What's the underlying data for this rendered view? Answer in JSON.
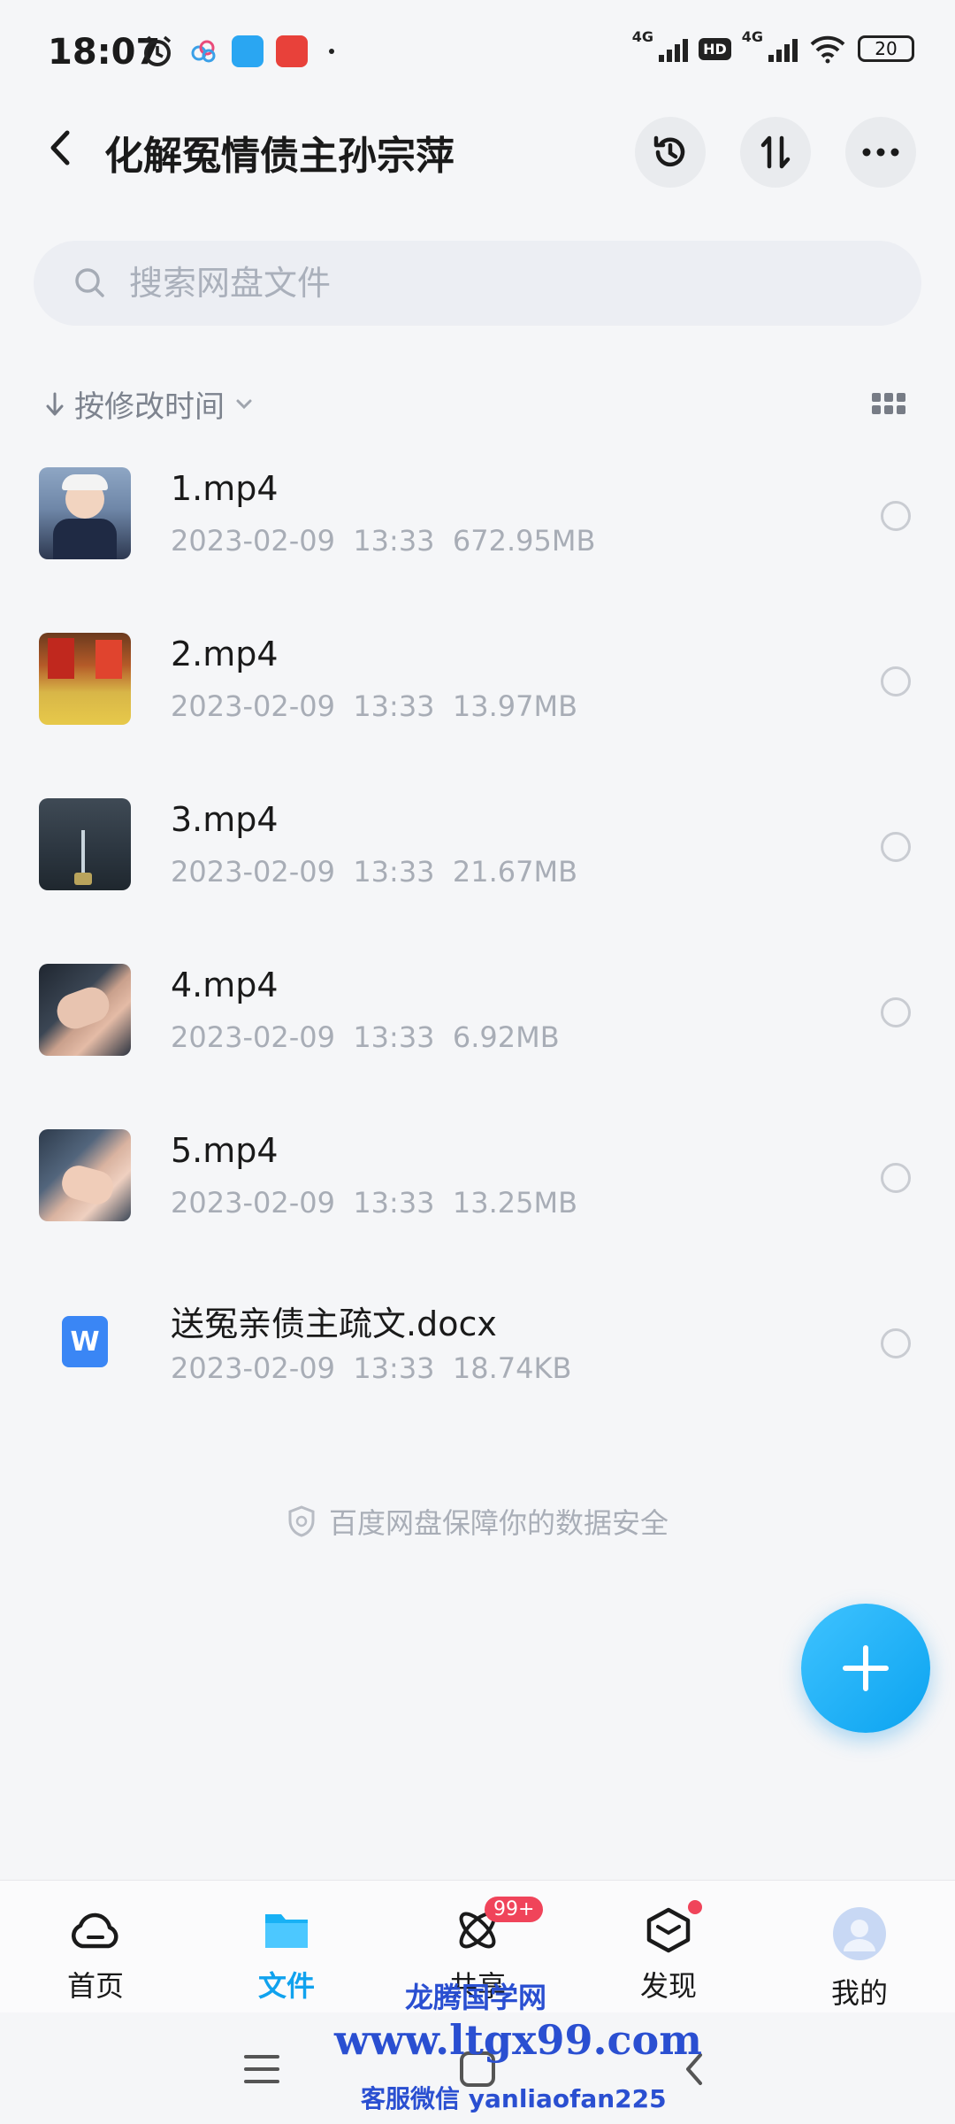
{
  "status": {
    "time": "18:07",
    "net1": "4G",
    "net2": "4G",
    "hd": "HD",
    "battery": "20"
  },
  "header": {
    "title": "化解冤情债主孙宗萍"
  },
  "search": {
    "placeholder": "搜索网盘文件"
  },
  "sort": {
    "label": "按修改时间"
  },
  "files": [
    {
      "name": "1.mp4",
      "date": "2023-02-09",
      "time": "13:33",
      "size": "672.95MB"
    },
    {
      "name": "2.mp4",
      "date": "2023-02-09",
      "time": "13:33",
      "size": "13.97MB"
    },
    {
      "name": "3.mp4",
      "date": "2023-02-09",
      "time": "13:33",
      "size": "21.67MB"
    },
    {
      "name": "4.mp4",
      "date": "2023-02-09",
      "time": "13:33",
      "size": "6.92MB"
    },
    {
      "name": "5.mp4",
      "date": "2023-02-09",
      "time": "13:33",
      "size": "13.25MB"
    },
    {
      "name": "送冤亲债主疏文.docx",
      "date": "2023-02-09",
      "time": "13:33",
      "size": "18.74KB"
    }
  ],
  "footer_note": "百度网盘保障你的数据安全",
  "tabs": [
    {
      "label": "首页"
    },
    {
      "label": "文件"
    },
    {
      "label": "共享",
      "badge": "99+"
    },
    {
      "label": "发现"
    },
    {
      "label": "我的"
    }
  ],
  "watermark": {
    "line1": "龙腾国学网",
    "line2": "www.ltgx99.com",
    "line3": "客服微信 yanliaofan225"
  },
  "colors": {
    "accent": "#10a2ee",
    "badge": "#f0445a",
    "word": "#3a86f5"
  }
}
